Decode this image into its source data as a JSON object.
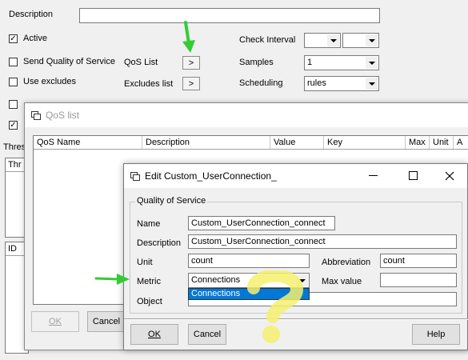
{
  "main": {
    "description_label": "Description",
    "description_value": "",
    "active_label": "Active",
    "active_checked": true,
    "send_qos_label": "Send Quality of Service",
    "use_excludes_label": "Use excludes",
    "qos_list_label": "QoS List",
    "qos_list_button": ">",
    "excludes_list_label": "Excludes list",
    "excludes_button": ">",
    "check_interval_label": "Check Interval",
    "samples_label": "Samples",
    "samples_value": "1",
    "scheduling_label": "Scheduling",
    "scheduling_value": "rules",
    "thresholds_label": "Thres",
    "table_col_thr": "Thr",
    "table_col_id": "ID"
  },
  "qos_list": {
    "title": "QoS list",
    "columns": [
      "QoS Name",
      "Description",
      "Value",
      "Key",
      "Max",
      "Unit",
      "A"
    ],
    "ok_label": "OK",
    "cancel_label": "Cancel"
  },
  "edit_dialog": {
    "title": "Edit Custom_UserConnection_",
    "group_label": "Quality of Service",
    "name_label": "Name",
    "name_value": "Custom_UserConnection_connect",
    "description_label": "Description",
    "description_value": "Custom_UserConnection_connect",
    "unit_label": "Unit",
    "unit_value": "count",
    "abbreviation_label": "Abbreviation",
    "abbreviation_value": "count",
    "metric_label": "Metric",
    "metric_value": "Connections",
    "max_value_label": "Max value",
    "max_value_value": "",
    "object_label": "Object",
    "object_value": "",
    "dropdown_options": [
      "Connections"
    ],
    "ok_label": "OK",
    "cancel_label": "Cancel",
    "help_label": "Help"
  },
  "annotations": {
    "arrow_color": "#33cc33",
    "highlight_color": "#f5f06e",
    "question_mark": "?"
  }
}
